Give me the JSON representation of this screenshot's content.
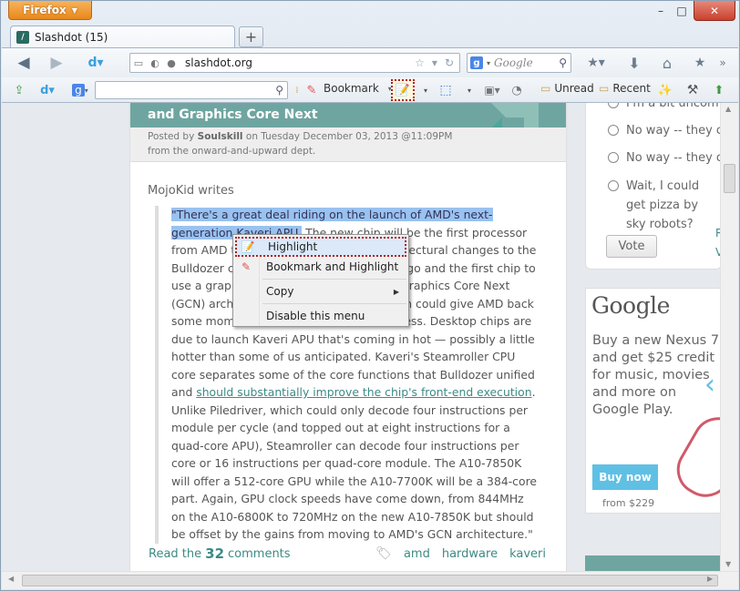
{
  "app": {
    "firefox_button": "Firefox",
    "window_controls": {
      "minimize": "–",
      "maximize": "□",
      "close": "✕"
    }
  },
  "tab": {
    "title": "Slashdot (15)",
    "new_tab": "+"
  },
  "navbar": {
    "url": "slashdot.org",
    "search_placeholder": "Google"
  },
  "bookmarks_bar": {
    "bookmark_label": "Bookmark",
    "unread_label": "Unread",
    "recent_label": "Recent"
  },
  "article": {
    "title": "and Graphics Core Next",
    "posted_by_prefix": "Posted by",
    "author": "Soulskill",
    "posted_on": "on Tuesday December 03, 2013 @11:09PM",
    "dept": "from the onward-and-upward dept.",
    "writes": "MojoKid writes",
    "quote_selected": "\"There's a great deal riding on the launch of AMD's next-generation Kaveri APU.",
    "quote_p1": " The new chip will be the first processor from AMD to incorporate significant architectural changes to the Bulldozer core AMD launched two years ago and the first chip to use a graphics core derived from AMD's Graphics Core Next (GCN) architecture. A strong Kaveri launch could give AMD back some momentum in the enthusiast business. Desktop chips are due to launch Kaveri APU that's coming in hot — possibly a little hotter than some of us anticipated. Kaveri's Steamroller CPU core separates some of the core functions that Bulldozer unified and ",
    "quote_link": "should substantially improve the chip's front-end execution",
    "quote_p2": ". Unlike Piledriver, which could only decode four instructions per module per cycle (and topped out at eight instructions for a quad-core APU), Steamroller can decode four instructions per core or 16 instructions per quad-core module. The A10-7850K will offer a 512-core GPU while the A10-7700K will be a 384-core part. Again, GPU clock speeds have come down, from 844MHz on the A10-6800K to 720MHz on the new A10-7850K but should be offset by the gains from moving to AMD's GCN architecture.\"",
    "read_prefix": "Read the",
    "comment_count": "32",
    "read_suffix": "comments",
    "tags": [
      "amd",
      "hardware",
      "kaveri"
    ]
  },
  "poll": {
    "options": [
      "I'm a bit uncomfortable",
      "No way -- they can",
      "No way -- they can",
      "Wait, I could get pizza by sky robots?"
    ],
    "vote_button": "Vote",
    "side_labels": [
      "R",
      "V"
    ]
  },
  "ad": {
    "logo": "Google",
    "text": "Buy a new Nexus 7 and get $25 credit for music, movies and more on Google Play.",
    "buy_button": "Buy now",
    "price": "from $229"
  },
  "context_menu": {
    "items": [
      {
        "label": "Highlight",
        "icon": "highlight-icon"
      },
      {
        "label": "Bookmark and Highlight",
        "icon": "bookmark-highlight-icon"
      },
      {
        "label": "Copy",
        "icon": ""
      },
      {
        "label": "Disable this menu",
        "icon": ""
      }
    ]
  }
}
